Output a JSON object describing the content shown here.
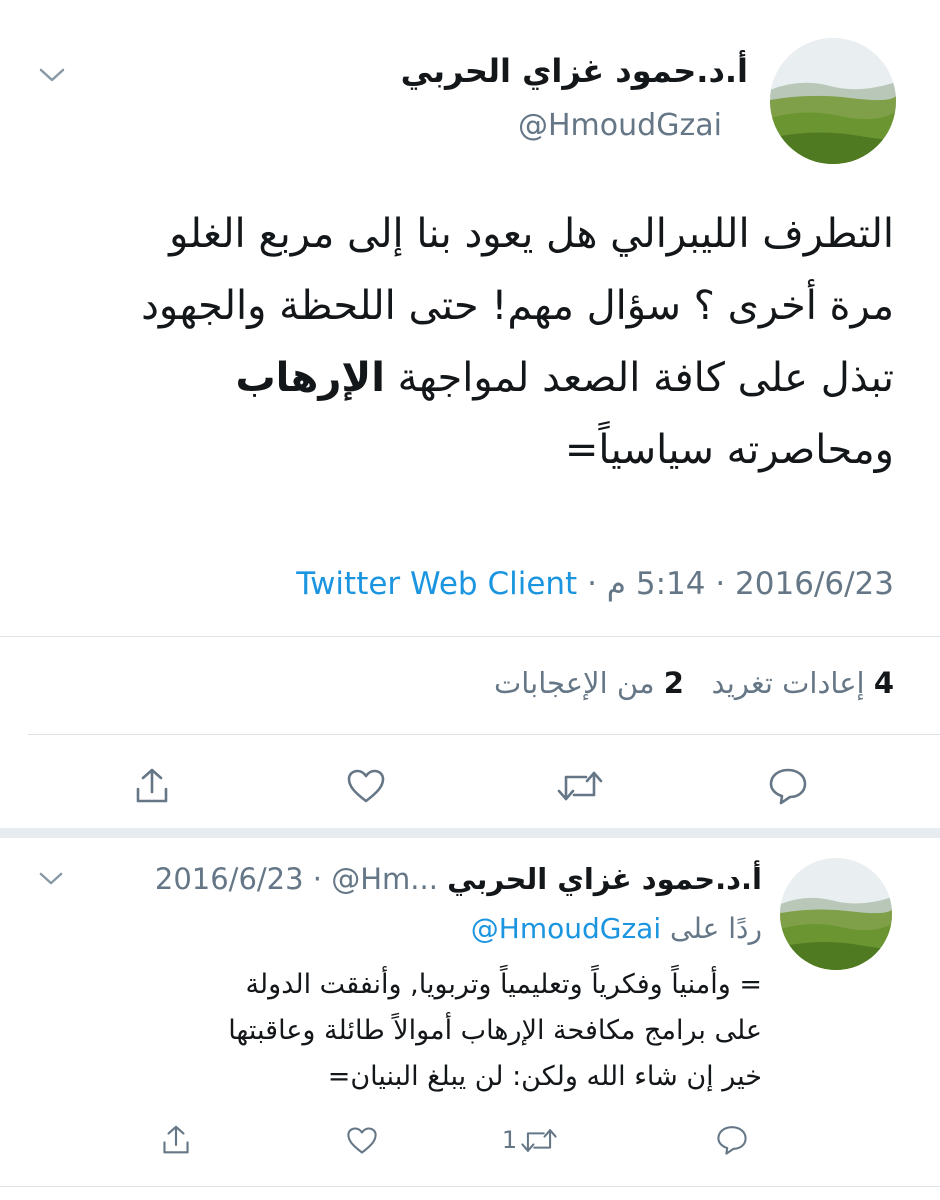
{
  "main_tweet": {
    "author_name": "أ.د.حمود غزاي الحربي",
    "author_handle": "@HmoudGzai",
    "text_line1": "التطرف الليبرالي هل يعود بنا إلى مربع الغلو",
    "text_line2": "مرة أخرى ؟ سؤال مهم! حتى اللحظة والجهود",
    "text_line3_a": "تبذل على كافة الصعد لمواجهة ",
    "text_line3_bold": "الإرهاب",
    "text_line4": "ومحاصرته سياسياً=",
    "date": "2016/6/23",
    "time": "5:14 م",
    "client": "Twitter Web Client",
    "sep": "·",
    "retweets_count": "4",
    "retweets_label": "إعادات تغريد",
    "likes_count": "2",
    "likes_label": "من الإعجابات"
  },
  "reply_tweet": {
    "author_name": "أ.د.حمود غزاي الحربي",
    "author_handle_trunc": "@Hm...",
    "date": "2016/6/23",
    "sep": "·",
    "replying_prefix": "ردًا على",
    "replying_to": "@HmoudGzai",
    "text_line1": "= وأمنياً وفكرياً وتعليمياً وتربويا, وأنفقت الدولة",
    "text_line2": "على برامج مكافحة الإرهاب أموالاً طائلة وعاقبتها",
    "text_line3": "خير إن شاء الله ولكن: لن يبلغ البنيان=",
    "retweet_count": "1"
  }
}
